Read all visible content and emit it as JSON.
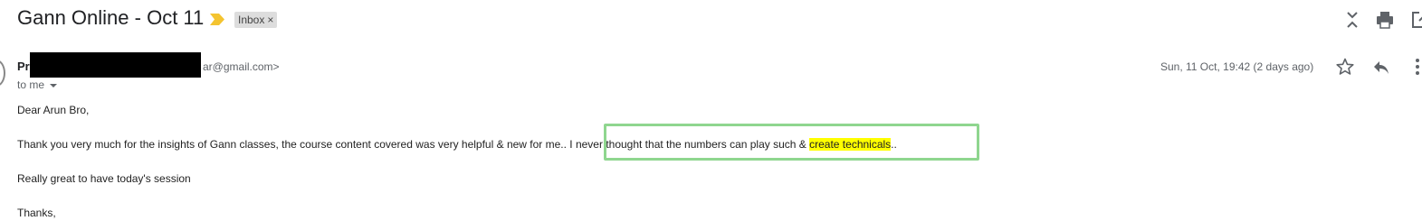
{
  "email": {
    "subject": "Gann Online - Oct 11",
    "label": "Inbox",
    "label_close": "×",
    "sender_name": "Pr",
    "sender_email": "ar@gmail.com>",
    "recipient": "to me",
    "date": "Sun, 11 Oct, 19:42 (2 days ago)",
    "body": {
      "greeting": "Dear Arun Bro,",
      "para1_start": "Thank you very much for the insights of Gann classes, the course content covered was very helpful & new for me.. I never thought that the numbers can play such & ",
      "para1_highlight": "create technicals",
      "para1_end": "..",
      "para2": "Really great to have today's session",
      "closing": "Thanks,"
    }
  },
  "icons": {
    "importance": "importance-marker-icon",
    "collapse": "collapse-all-icon",
    "print": "print-icon",
    "new_window": "open-in-new-window-icon",
    "star": "star-icon",
    "reply": "reply-icon",
    "more": "more-vertical-icon"
  },
  "colors": {
    "importance": "#f4c430",
    "highlight": "#ffff00",
    "callout_border": "#8fd68f",
    "redaction": "#000000"
  }
}
